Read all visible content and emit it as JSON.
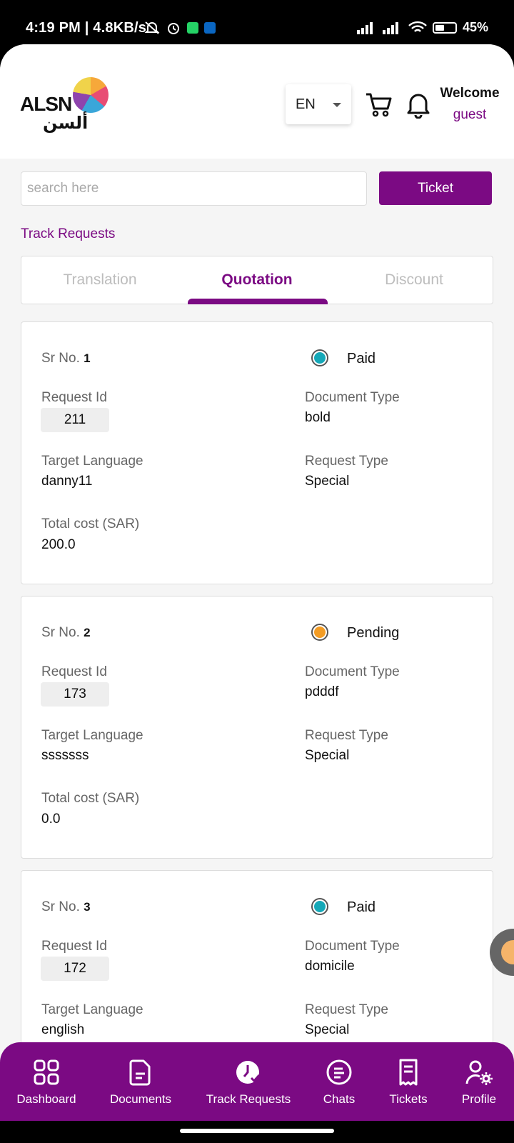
{
  "status_bar": {
    "time": "4:19 PM | 4.8KB/s",
    "battery": "45%"
  },
  "header": {
    "logo_latin": "ALSN",
    "logo_arabic": "ألسن",
    "language": "EN",
    "welcome": "Welcome",
    "user": "guest"
  },
  "search": {
    "placeholder": "search here",
    "ticket_label": "Ticket"
  },
  "page": {
    "title": "Track Requests"
  },
  "tabs": [
    "Translation",
    "Quotation",
    "Discount"
  ],
  "labels": {
    "sr_no": "Sr No.",
    "request_id": "Request Id",
    "document_type": "Document Type",
    "target_language": "Target Language",
    "request_type": "Request Type",
    "total_cost": "Total cost (SAR)"
  },
  "colors": {
    "accent": "#7b0a83",
    "paid": "#15a8b8",
    "pending": "#f39c24"
  },
  "requests": [
    {
      "sr": "1",
      "status": "Paid",
      "request_id": "211",
      "document_type": "bold",
      "target_language": "danny11",
      "request_type": "Special",
      "total_cost": "200.0"
    },
    {
      "sr": "2",
      "status": "Pending",
      "request_id": "173",
      "document_type": "pdddf",
      "target_language": "sssssss",
      "request_type": "Special",
      "total_cost": "0.0"
    },
    {
      "sr": "3",
      "status": "Paid",
      "request_id": "172",
      "document_type": "domicile",
      "target_language": "english",
      "request_type": "Special"
    }
  ],
  "bottom_nav": [
    "Dashboard",
    "Documents",
    "Track Requests",
    "Chats",
    "Tickets",
    "Profile"
  ]
}
